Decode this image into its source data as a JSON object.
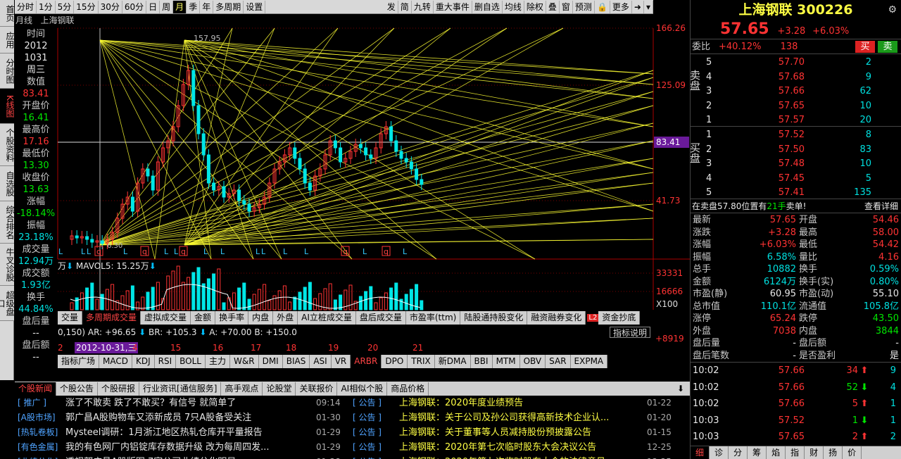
{
  "left_tabs": [
    "首页",
    "应用",
    "分时图",
    "K线图",
    "个股资料",
    "自选股",
    "综合排名",
    "牛叉诊股",
    "超级盘口"
  ],
  "toolbar": {
    "left": [
      "分时",
      "1分",
      "5分",
      "15分",
      "30分",
      "60分",
      "日",
      "周",
      "月",
      "季",
      "年",
      "多周期",
      "设置"
    ],
    "right": [
      "发",
      "简",
      "九转",
      "重大事件",
      "删自选",
      "均线",
      "除权",
      "叠",
      "窗",
      "预测",
      "",
      "更多",
      "",
      ""
    ]
  },
  "chart_header": {
    "period": "月线",
    "name": "上海钢联"
  },
  "info": [
    {
      "v": "时间",
      "c": "lbl"
    },
    {
      "v": "2012",
      "c": "wht"
    },
    {
      "v": "1031",
      "c": "wht"
    },
    {
      "v": "周三",
      "c": "wht"
    },
    {
      "v": "数值",
      "c": "lbl"
    },
    {
      "v": "83.41",
      "c": "red"
    },
    {
      "v": "开盘价",
      "c": "lbl"
    },
    {
      "v": "16.41",
      "c": "grn"
    },
    {
      "v": "最高价",
      "c": "lbl"
    },
    {
      "v": "17.16",
      "c": "red"
    },
    {
      "v": "最低价",
      "c": "lbl"
    },
    {
      "v": "13.30",
      "c": "grn"
    },
    {
      "v": "收盘价",
      "c": "lbl"
    },
    {
      "v": "13.63",
      "c": "grn"
    },
    {
      "v": "涨幅",
      "c": "lbl"
    },
    {
      "v": "-18.14%",
      "c": "grn"
    },
    {
      "v": "振幅",
      "c": "lbl"
    },
    {
      "v": "23.18%",
      "c": "cyn"
    },
    {
      "v": "成交量",
      "c": "lbl"
    },
    {
      "v": "12.94万",
      "c": "cyn"
    },
    {
      "v": "成交额",
      "c": "lbl"
    },
    {
      "v": "1.93亿",
      "c": "cyn"
    },
    {
      "v": "换手",
      "c": "lbl"
    },
    {
      "v": "44.84%",
      "c": "cyn"
    },
    {
      "v": "盘后量",
      "c": "lbl"
    },
    {
      "v": "--",
      "c": "wht"
    },
    {
      "v": "盘后额",
      "c": "lbl"
    },
    {
      "v": "--",
      "c": "wht"
    }
  ],
  "price_axis": [
    "166.26",
    "125.09",
    "83.41",
    "41.73"
  ],
  "peak_label": "157.95",
  "low_label": "6.30",
  "vol_axis": [
    "33331",
    "16666",
    "X100"
  ],
  "vol_header": {
    "unit": "万",
    "mavol": "MAVOL5: 15.25万"
  },
  "ind_tabs": [
    "交量",
    "多周期成交量",
    "虚拟成交量",
    "金额",
    "换手率",
    "内盘",
    "外盘",
    "AI立桩成交量",
    "盘后成交量",
    "市盈率(ttm)",
    "陆股通持股变化",
    "融资融券变化",
    "资金抄底"
  ],
  "ind_tab_badge": "L2",
  "ind_values": {
    "params": "0,150)",
    "ar": "AR: +96.65",
    "br": "BR: +105.3",
    "a": "A: +70.00",
    "b": "B: +150.0",
    "btn": "指标说明",
    "val": "+8919"
  },
  "x_axis": {
    "labels": [
      "2",
      "2012-10-31,三",
      "4",
      "15",
      "16",
      "17",
      "18",
      "19",
      "20",
      "21"
    ]
  },
  "ind_tabs2": [
    "指标广场",
    "MACD",
    "KDJ",
    "RSI",
    "BOLL",
    "主力",
    "W&R",
    "DMI",
    "BIAS",
    "ASI",
    "VR",
    "ARBR",
    "DPO",
    "TRIX",
    "新DMA",
    "BBI",
    "MTM",
    "OBV",
    "SAR",
    "EXPMA"
  ],
  "news_tabs": [
    "个股新闻",
    "个股公告",
    "个股研报",
    "行业资讯[通信服务]",
    "高手观点",
    "论股堂",
    "关联报价",
    "AI相似个股",
    "商品价格"
  ],
  "news": [
    {
      "tag": "[ 推广 ]",
      "title": "涨了不敢卖 跌了不敢买？有信号 就简单了",
      "date": "09:14",
      "tag2": "[ 公告 ]",
      "title2": "上海钢联：2020年度业绩预告",
      "date2": "01-22"
    },
    {
      "tag": "[A股市场]",
      "title": "郭广昌A股购物车又添新成员 7只A股备受关注",
      "date": "01-30",
      "tag2": "[ 公告 ]",
      "title2": "上海钢联：关于公司及孙公司获得高新技术企业认...",
      "date2": "01-20"
    },
    {
      "tag": "[热轧卷板]",
      "title": "Mysteel调研：1月浙江地区热轧仓库开平量报告",
      "date": "01-29",
      "tag2": "[ 公告 ]",
      "title2": "上海钢联：关于董事等人员减持股份预披露公告",
      "date2": "01-15"
    },
    {
      "tag": "[有色金属]",
      "title": "我的有色网厂内铝锭库存数据升级 改为每周四发...",
      "date": "01-29",
      "tag2": "[ 公告 ]",
      "title2": "上海钢联：2020年第七次临时股东大会决议公告",
      "date2": "12-25"
    },
    {
      "tag": "[业绩分化]",
      "title": "透视郭广昌A股版图 7家公司业绩分化明显",
      "date": "01-28",
      "tag2": "[ 公告 ]",
      "title2": "上海钢联：2020年第七次临时股东大会的法律意见...",
      "date2": "12-25"
    }
  ],
  "quote": {
    "name": "上海钢联 300226",
    "price": "57.65",
    "change": "+3.28",
    "pct": "+6.03%",
    "weibi_label": "委比",
    "weibi": "+40.12%",
    "weicha": "138",
    "buy_btn": "买",
    "sell_btn": "卖",
    "sell_side_label": "卖盘",
    "buy_side_label": "买盘",
    "asks": [
      {
        "lv": "5",
        "p": "57.70",
        "v": "2"
      },
      {
        "lv": "4",
        "p": "57.68",
        "v": "9"
      },
      {
        "lv": "3",
        "p": "57.66",
        "v": "62"
      },
      {
        "lv": "2",
        "p": "57.65",
        "v": "10"
      },
      {
        "lv": "1",
        "p": "57.57",
        "v": "20"
      }
    ],
    "bids": [
      {
        "lv": "1",
        "p": "57.52",
        "v": "8"
      },
      {
        "lv": "2",
        "p": "57.50",
        "v": "83"
      },
      {
        "lv": "3",
        "p": "57.48",
        "v": "10"
      },
      {
        "lv": "4",
        "p": "57.45",
        "v": "5"
      },
      {
        "lv": "5",
        "p": "57.41",
        "v": "135"
      }
    ],
    "notice_prefix": "在卖盘57.80位置有",
    "notice_hl": "21手",
    "notice_suffix": "卖单!",
    "detail_link": "查看详细",
    "stats": [
      [
        "最新",
        "57.65",
        "red",
        "开盘",
        "54.46",
        "red"
      ],
      [
        "涨跌",
        "+3.28",
        "red",
        "最高",
        "58.00",
        "red"
      ],
      [
        "涨幅",
        "+6.03%",
        "red",
        "最低",
        "54.42",
        "red"
      ],
      [
        "振幅",
        "6.58%",
        "cyn",
        "量比",
        "4.16",
        "red"
      ],
      [
        "总手",
        "10882",
        "cyn",
        "换手",
        "0.59%",
        "cyn"
      ],
      [
        "金额",
        "6124万",
        "cyn",
        "换手(实)",
        "0.80%",
        "cyn"
      ],
      [
        "市盈(静)",
        "60.95",
        "wht",
        "市盈(动)",
        "55.10",
        "wht"
      ],
      [
        "总市值",
        "110.1亿",
        "cyn",
        "流通值",
        "105.8亿",
        "cyn"
      ],
      [
        "涨停",
        "65.24",
        "red",
        "跌停",
        "43.50",
        "grn"
      ],
      [
        "外盘",
        "7038",
        "red",
        "内盘",
        "3844",
        "grn"
      ],
      [
        "盘后量",
        "-",
        "wht",
        "盘后额",
        "-",
        "wht"
      ],
      [
        "盘后笔数",
        "-",
        "wht",
        "是否盈利",
        "是",
        "wht"
      ]
    ],
    "ticks": [
      {
        "t": "10:02",
        "p": "57.66",
        "v": "34",
        "d": "up",
        "n": "9"
      },
      {
        "t": "10:02",
        "p": "57.66",
        "v": "52",
        "d": "dn",
        "n": "4"
      },
      {
        "t": "10:02",
        "p": "57.66",
        "v": "5",
        "d": "up",
        "n": "1"
      },
      {
        "t": "10:03",
        "p": "57.52",
        "v": "1",
        "d": "dn",
        "n": "1"
      },
      {
        "t": "10:03",
        "p": "57.65",
        "v": "2",
        "d": "up",
        "n": "2"
      }
    ],
    "bottom_tabs": [
      "细",
      "诊",
      "分",
      "筹",
      "焰",
      "指",
      "财",
      "扬",
      "价"
    ]
  },
  "colors": {
    "up": "#ff3333",
    "down": "#00e6e6",
    "grid": "#7a0000",
    "yellow": "#ffff33"
  }
}
